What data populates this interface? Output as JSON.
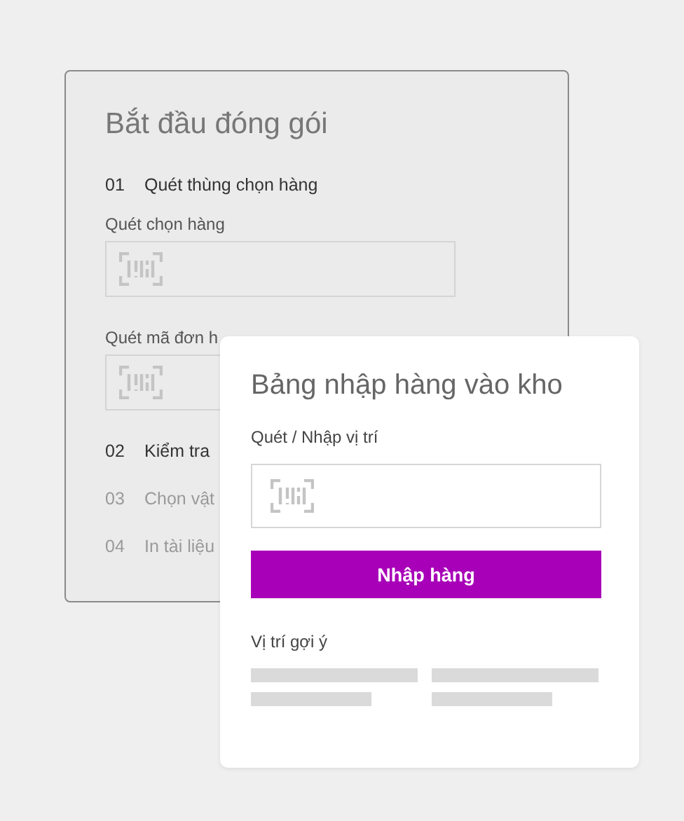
{
  "packing_card": {
    "title": "Bắt đầu đóng gói",
    "steps": [
      {
        "number": "01",
        "label": "Quét thùng chọn hàng",
        "disabled": false,
        "fields": [
          {
            "label": "Quét chọn hàng"
          },
          {
            "label": "Quét mã đơn h"
          }
        ]
      },
      {
        "number": "02",
        "label": "Kiểm tra",
        "disabled": false
      },
      {
        "number": "03",
        "label": "Chọn vật",
        "disabled": true
      },
      {
        "number": "04",
        "label": "In tài liệu",
        "disabled": true
      }
    ]
  },
  "inbound_panel": {
    "title": "Bảng nhập hàng vào kho",
    "field_label": "Quét / Nhập vị trí",
    "button": "Nhập hàng",
    "suggestions_label": "Vị trí gợi ý"
  }
}
